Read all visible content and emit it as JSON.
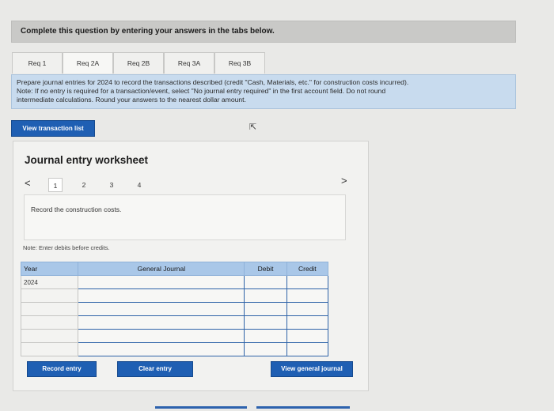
{
  "header": {
    "title": "Complete this question by entering your answers in the tabs below."
  },
  "tabs": [
    {
      "label": "Req 1"
    },
    {
      "label": "Req 2A"
    },
    {
      "label": "Req 2B"
    },
    {
      "label": "Req 3A"
    },
    {
      "label": "Req 3B"
    }
  ],
  "instruction": {
    "line1": "Prepare journal entries for 2024 to record the transactions described (credit \"Cash, Materials, etc.\" for construction costs incurred).",
    "line2": "Note: If no entry is required for a transaction/event, select \"No journal entry required\" in the first account field. Do not round",
    "line3": "intermediate calculations. Round your answers to the nearest dollar amount."
  },
  "buttons": {
    "view_transaction_list": "View transaction list",
    "record_entry": "Record entry",
    "clear_entry": "Clear entry",
    "view_general_journal": "View general journal"
  },
  "worksheet": {
    "title": "Journal entry worksheet",
    "steps": [
      "1",
      "2",
      "3",
      "4"
    ],
    "prev_arrow": "<",
    "next_arrow": ">",
    "prompt": "Record the construction costs.",
    "note": "Note: Enter debits before credits."
  },
  "journal": {
    "columns": [
      "Year",
      "General Journal",
      "Debit",
      "Credit"
    ],
    "rows": [
      {
        "year": "2024"
      },
      {
        "year": ""
      },
      {
        "year": ""
      },
      {
        "year": ""
      },
      {
        "year": ""
      },
      {
        "year": ""
      }
    ]
  },
  "colors": {
    "accent": "#1f5fb3",
    "instruction_bg": "#c8dbee",
    "table_header": "#a9c7e8"
  }
}
